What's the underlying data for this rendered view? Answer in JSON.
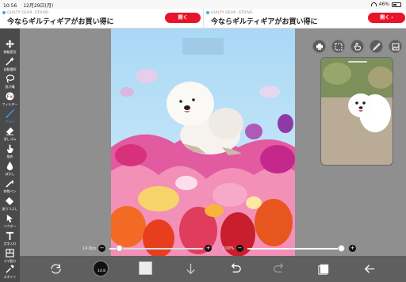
{
  "status": {
    "time": "10:56",
    "date": "12月29日(月)",
    "battery": "46%"
  },
  "ads": [
    {
      "source": "GUILTY GEAR -STRIVE-",
      "message": "今ならギルティギアがお買い得に",
      "button": "開く"
    },
    {
      "source": "GUILTY GEAR -STRIVE-",
      "message": "今ならギルティギアがお買い得に",
      "button": "開く ›"
    }
  ],
  "tools": [
    {
      "label": "移動変形",
      "icon": "move-icon",
      "selected": false
    },
    {
      "label": "自動選択",
      "icon": "magic-wand-icon",
      "selected": false
    },
    {
      "label": "投げ縄",
      "icon": "lasso-icon",
      "selected": false
    },
    {
      "label": "フィルター",
      "icon": "filter-icon",
      "selected": false
    },
    {
      "label": "ブラシ",
      "icon": "brush-icon",
      "selected": true
    },
    {
      "label": "消しゴム",
      "icon": "eraser-icon",
      "selected": false
    },
    {
      "label": "指先",
      "icon": "finger-icon",
      "selected": false
    },
    {
      "label": "ぼかし",
      "icon": "blur-icon",
      "selected": false
    },
    {
      "label": "特殊ペン",
      "icon": "special-pen-icon",
      "selected": false
    },
    {
      "label": "塗りつぶし",
      "icon": "bucket-icon",
      "selected": false
    },
    {
      "label": "ベクター",
      "icon": "vector-icon",
      "selected": false
    },
    {
      "label": "文字入れ",
      "icon": "text-icon",
      "selected": false
    },
    {
      "label": "コマ割り",
      "icon": "frame-icon",
      "selected": false
    },
    {
      "label": "スポイト",
      "icon": "eyedropper-icon",
      "selected": false
    }
  ],
  "sliders": {
    "brush_size": {
      "label": "14.8px",
      "value": 0.1
    },
    "opacity": {
      "label": "100%",
      "value": 1.0
    }
  },
  "bottom": {
    "brush_size_badge": "14.8"
  },
  "right_tools": [
    "print-icon",
    "selection-icon",
    "hand-icon",
    "pen-icon",
    "image-icon"
  ],
  "colors": {
    "accent": "#3d9dff",
    "ad_button": "#e8142a",
    "toolbar": "#4a4a4a"
  }
}
